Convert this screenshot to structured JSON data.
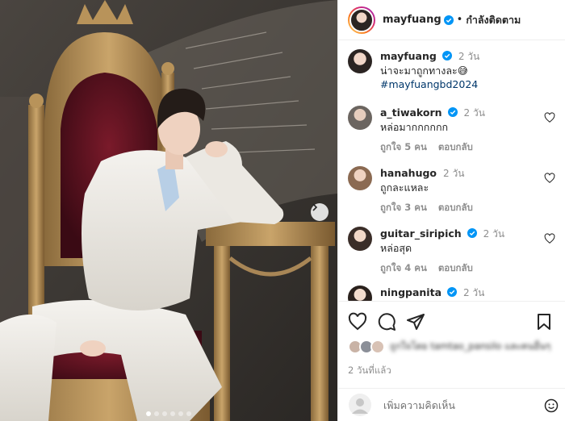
{
  "post": {
    "username": "mayfuang",
    "follow_label": "กำลังติดตาม",
    "caption_time": "2 วัน",
    "caption_text": "น่าจะมาถูกทางละ😅",
    "caption_hashtag": "#mayfuangbd2024",
    "carousel_slides": 6,
    "carousel_active": 1
  },
  "comments": [
    {
      "user": "a_tiwakorn",
      "verified": true,
      "time": "2 วัน",
      "text": "หล่อมากกกกกก",
      "likes": "ถูกใจ 5 คน",
      "reply": "ตอบกลับ"
    },
    {
      "user": "hanahugo",
      "verified": false,
      "time": "2 วัน",
      "text": "ถูกละแหละ",
      "likes": "ถูกใจ 3 คน",
      "reply": "ตอบกลับ"
    },
    {
      "user": "guitar_siripich",
      "verified": true,
      "time": "2 วัน",
      "text": "หล่อสุด",
      "likes": "ถูกใจ 4 คน",
      "reply": "ตอบกลับ"
    },
    {
      "user": "ningpanita",
      "verified": true,
      "time": "2 วัน",
      "text": "",
      "likes": "",
      "reply": ""
    }
  ],
  "likes_text": "ถูกใจโดย tamtao_pansilo และคนอื่นๆ",
  "posted_ago": "2 วันที่แล้ว",
  "add_comment_placeholder": "เพิ่มความคิดเห็น",
  "icons": [
    "verified-badge-icon",
    "heart-icon",
    "comment-icon",
    "share-icon",
    "bookmark-icon",
    "emoji-icon",
    "chevron-right-icon"
  ],
  "colors": {
    "verified": "#0095f6",
    "hashtag": "#00376b",
    "muted": "#8e8e8e",
    "text": "#262626",
    "border": "#efefef"
  }
}
